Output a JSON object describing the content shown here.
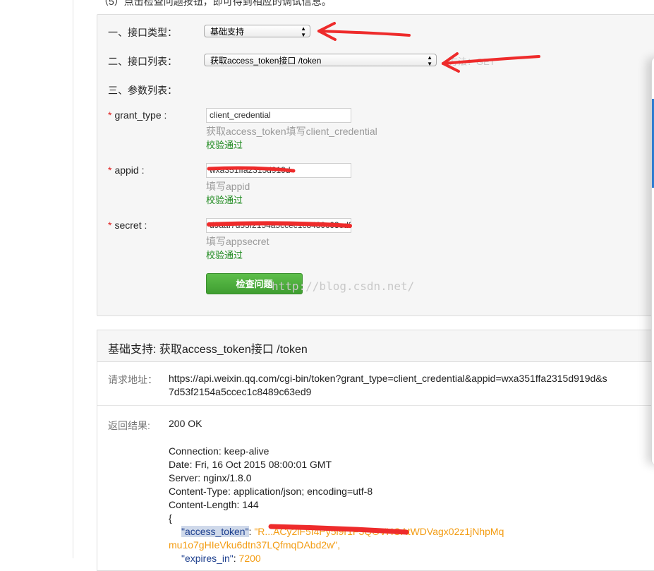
{
  "top_note": "（5）点击检查问题按钮，即可得到相应的调试信息。",
  "form": {
    "interface_type": {
      "label": "一、接口类型：",
      "selected": "基础支持"
    },
    "interface_list": {
      "label": "二、接口列表：",
      "selected": "获取access_token接口 /token",
      "method_note": "方法：GET"
    },
    "params_label": "三、参数列表：",
    "params": [
      {
        "required_mark": "*",
        "label": "grant_type :",
        "value": "client_credential",
        "hint": "获取access_token填写client_credential",
        "validation": "校验通过"
      },
      {
        "required_mark": "*",
        "label": "appid :",
        "value": "wxa351ffa2315d919d",
        "hint": "填写appid",
        "validation": "校验通过"
      },
      {
        "required_mark": "*",
        "label": "secret :",
        "value": "d9aaf7d53f2154a5ccec1c8489c63ed9",
        "hint": "填写appsecret",
        "validation": "校验通过"
      }
    ],
    "check_button": "检查问题",
    "watermark": "http://blog.csdn.net/"
  },
  "result": {
    "title": "基础支持: 获取access_token接口 /token",
    "request_label": "请求地址：",
    "request_url_line1": "https://api.weixin.qq.com/cgi-bin/token?grant_type=client_credential&appid=wxa351ffa2315d919d&s",
    "request_url_line2": "7d53f2154a5ccec1c8489c63ed9",
    "return_label": "返回结果:",
    "status": "200 OK",
    "headers": [
      "Connection: keep-alive",
      "Date: Fri, 16 Oct 2015 08:00:01 GMT",
      "Server: nginx/1.8.0",
      "Content-Type: application/json; encoding=utf-8",
      "Content-Length: 144"
    ],
    "brace_open": "{",
    "token_key": "\"access_token\"",
    "token_sep": ": ",
    "token_value_line1": "\"R...ACy2iF5I4Py5i9r1F3QOVHOAtWDVagx02z1jNhpMq",
    "token_value_line2": "mu1o7gHIeVku6dtn37LQfmqDAbd2w\",",
    "expires_key": "\"expires_in\"",
    "expires_sep": ": ",
    "expires_value": "7200"
  },
  "colors": {
    "annotation_red": "#ee2b2b",
    "valid_green": "#1e8a1e",
    "button_green": "#4cae3b",
    "json_orange": "#f39c12"
  }
}
